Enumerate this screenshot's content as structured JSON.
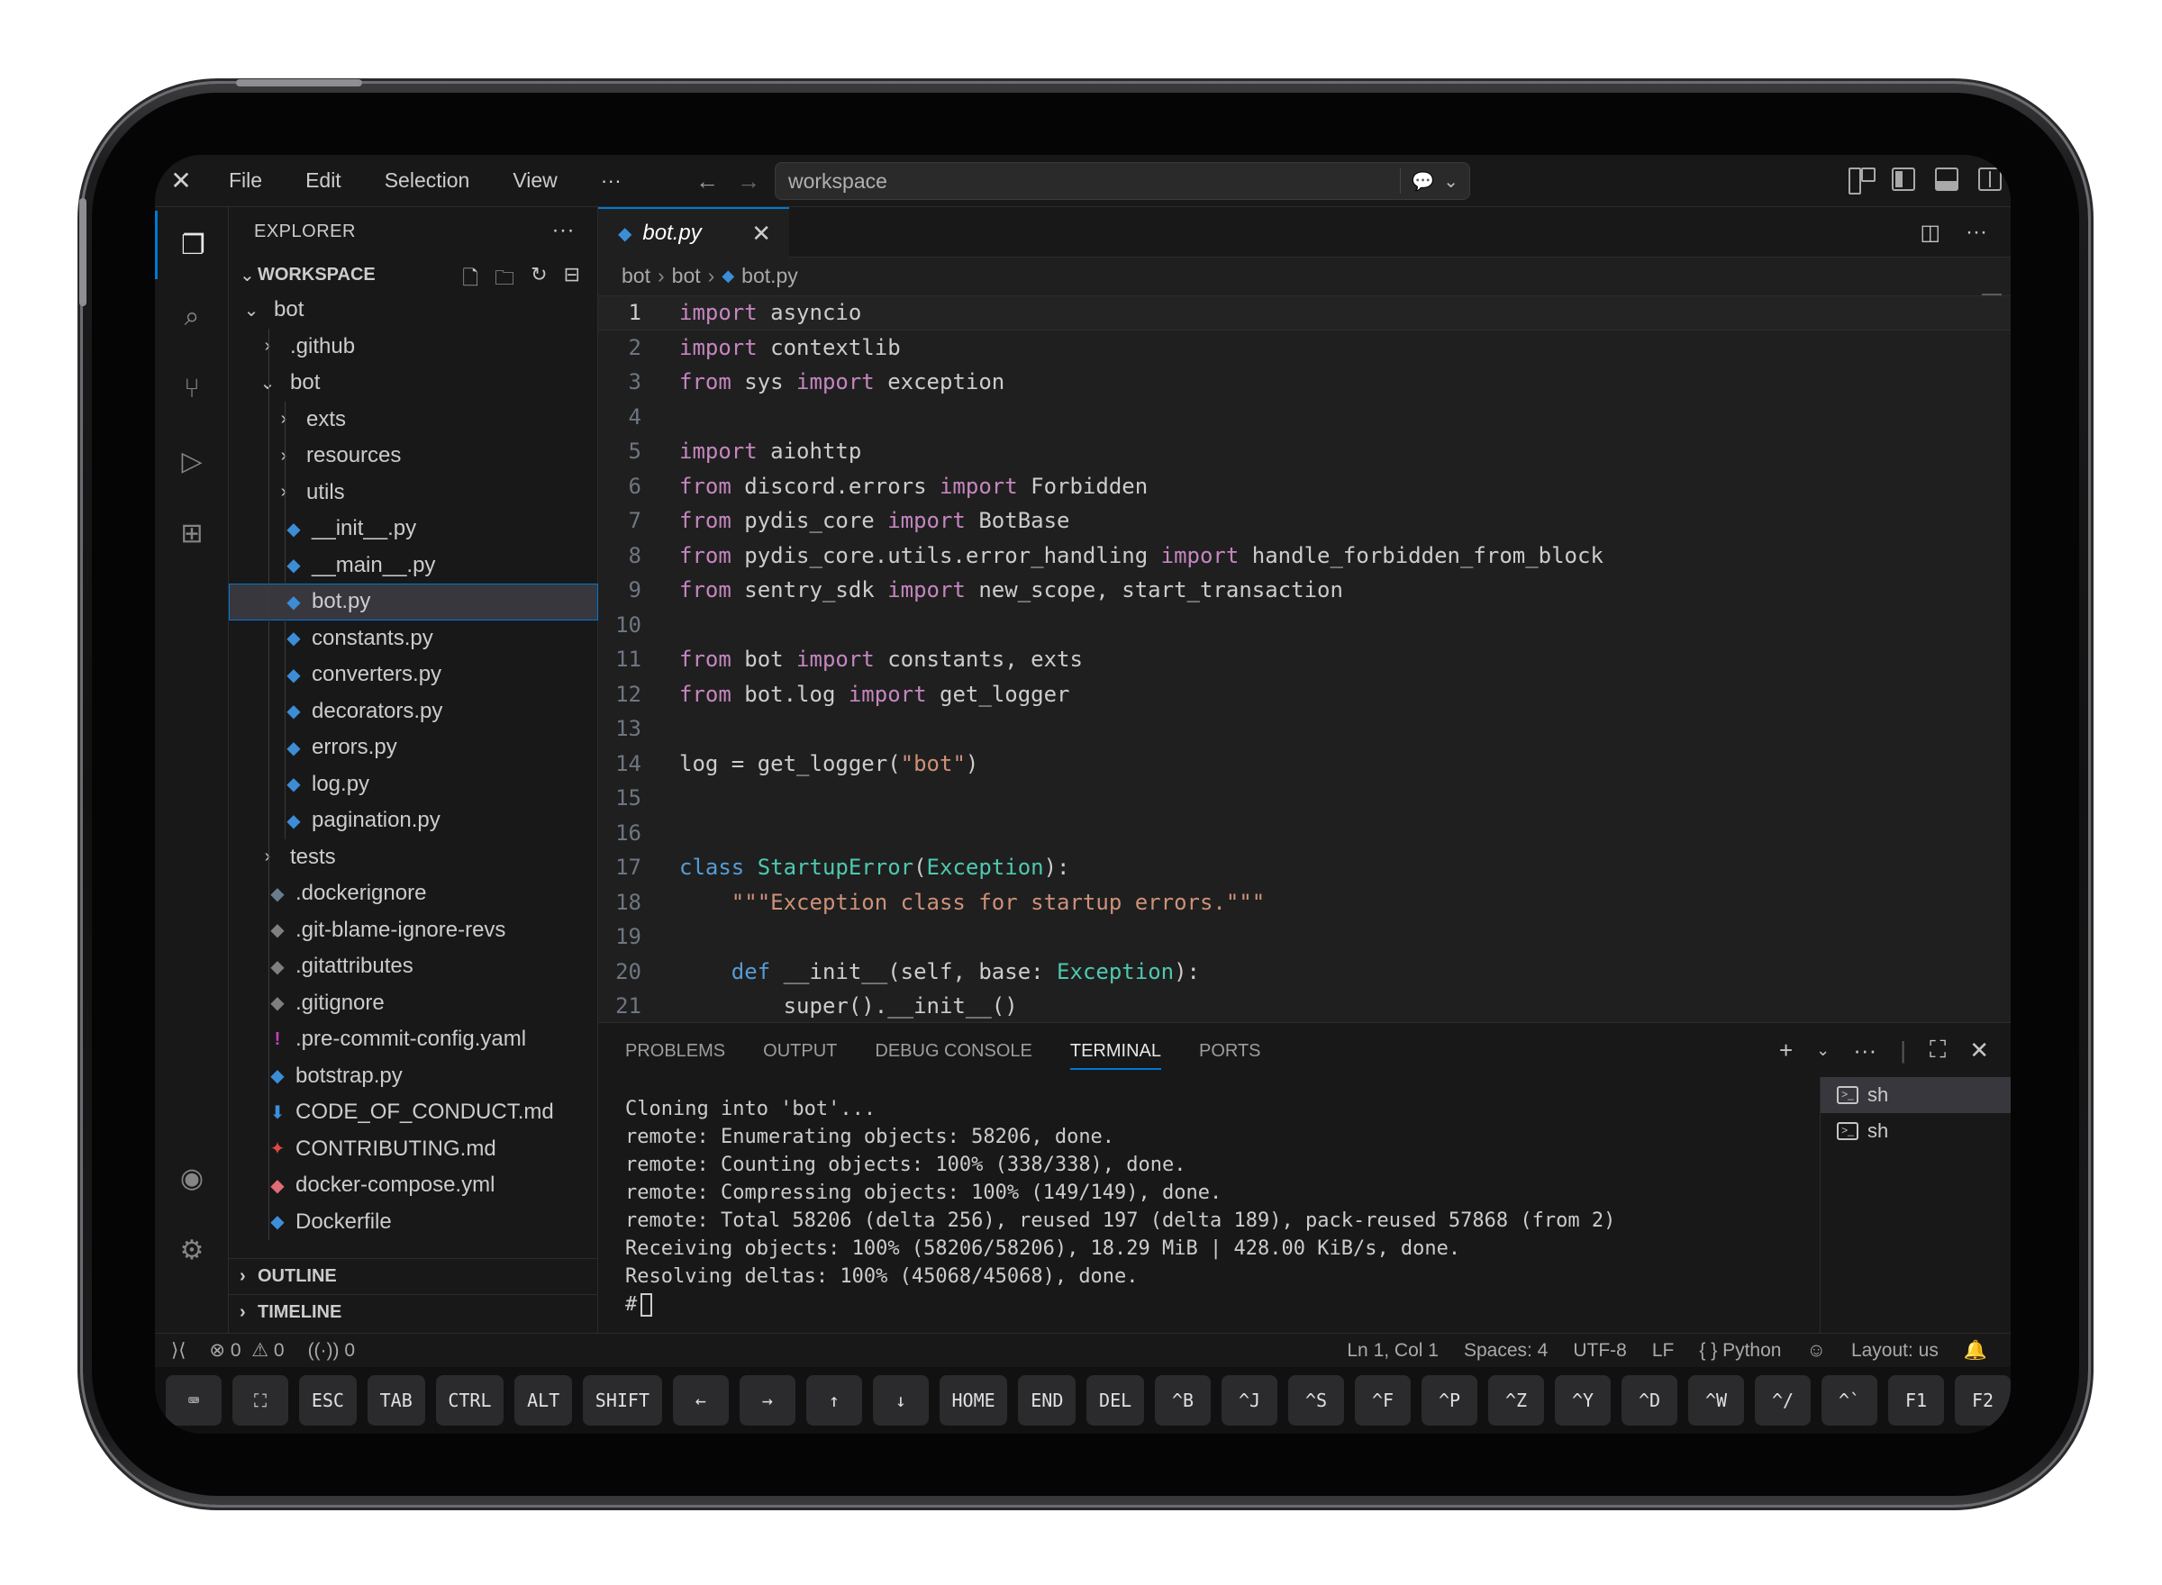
{
  "menu": {
    "items": [
      "File",
      "Edit",
      "Selection",
      "View",
      "···"
    ]
  },
  "search": {
    "text": "workspace"
  },
  "explorer": {
    "title": "EXPLORER",
    "workspace": "WORKSPACE",
    "tree": [
      {
        "label": "bot",
        "depth": 0,
        "kind": "folder-open"
      },
      {
        "label": ".github",
        "depth": 1,
        "kind": "folder"
      },
      {
        "label": "bot",
        "depth": 1,
        "kind": "folder-open"
      },
      {
        "label": "exts",
        "depth": 2,
        "kind": "folder"
      },
      {
        "label": "resources",
        "depth": 2,
        "kind": "folder"
      },
      {
        "label": "utils",
        "depth": 2,
        "kind": "folder"
      },
      {
        "label": "__init__.py",
        "depth": 2,
        "kind": "py"
      },
      {
        "label": "__main__.py",
        "depth": 2,
        "kind": "py"
      },
      {
        "label": "bot.py",
        "depth": 2,
        "kind": "py",
        "selected": true
      },
      {
        "label": "constants.py",
        "depth": 2,
        "kind": "py"
      },
      {
        "label": "converters.py",
        "depth": 2,
        "kind": "py"
      },
      {
        "label": "decorators.py",
        "depth": 2,
        "kind": "py"
      },
      {
        "label": "errors.py",
        "depth": 2,
        "kind": "py"
      },
      {
        "label": "log.py",
        "depth": 2,
        "kind": "py"
      },
      {
        "label": "pagination.py",
        "depth": 2,
        "kind": "py"
      },
      {
        "label": "tests",
        "depth": 1,
        "kind": "folder"
      },
      {
        "label": ".dockerignore",
        "depth": 1,
        "kind": "dockerignore"
      },
      {
        "label": ".git-blame-ignore-revs",
        "depth": 1,
        "kind": "git"
      },
      {
        "label": ".gitattributes",
        "depth": 1,
        "kind": "git"
      },
      {
        "label": ".gitignore",
        "depth": 1,
        "kind": "git"
      },
      {
        "label": ".pre-commit-config.yaml",
        "depth": 1,
        "kind": "yaml"
      },
      {
        "label": "botstrap.py",
        "depth": 1,
        "kind": "py"
      },
      {
        "label": "CODE_OF_CONDUCT.md",
        "depth": 1,
        "kind": "md"
      },
      {
        "label": "CONTRIBUTING.md",
        "depth": 1,
        "kind": "md-red"
      },
      {
        "label": "docker-compose.yml",
        "depth": 1,
        "kind": "compose"
      },
      {
        "label": "Dockerfile",
        "depth": 1,
        "kind": "dockerfile"
      }
    ],
    "outline": "OUTLINE",
    "timeline": "TIMELINE"
  },
  "editor": {
    "tab": "bot.py",
    "breadcrumb": [
      "bot",
      "bot",
      "bot.py"
    ],
    "lines": [
      {
        "n": "1",
        "tokens": [
          [
            "k",
            "import"
          ],
          [
            "p",
            " asyncio"
          ]
        ]
      },
      {
        "n": "2",
        "tokens": [
          [
            "k",
            "import"
          ],
          [
            "p",
            " contextlib"
          ]
        ]
      },
      {
        "n": "3",
        "tokens": [
          [
            "k",
            "from"
          ],
          [
            "p",
            " sys "
          ],
          [
            "k",
            "import"
          ],
          [
            "p",
            " exception"
          ]
        ]
      },
      {
        "n": "4",
        "tokens": []
      },
      {
        "n": "5",
        "tokens": [
          [
            "k",
            "import"
          ],
          [
            "p",
            " aiohttp"
          ]
        ]
      },
      {
        "n": "6",
        "tokens": [
          [
            "k",
            "from"
          ],
          [
            "p",
            " discord.errors "
          ],
          [
            "k",
            "import"
          ],
          [
            "p",
            " Forbidden"
          ]
        ]
      },
      {
        "n": "7",
        "tokens": [
          [
            "k",
            "from"
          ],
          [
            "p",
            " pydis_core "
          ],
          [
            "k",
            "import"
          ],
          [
            "p",
            " BotBase"
          ]
        ]
      },
      {
        "n": "8",
        "tokens": [
          [
            "k",
            "from"
          ],
          [
            "p",
            " pydis_core.utils.error_handling "
          ],
          [
            "k",
            "import"
          ],
          [
            "p",
            " handle_forbidden_from_block"
          ]
        ]
      },
      {
        "n": "9",
        "tokens": [
          [
            "k",
            "from"
          ],
          [
            "p",
            " sentry_sdk "
          ],
          [
            "k",
            "import"
          ],
          [
            "p",
            " new_scope, start_transaction"
          ]
        ]
      },
      {
        "n": "10",
        "tokens": []
      },
      {
        "n": "11",
        "tokens": [
          [
            "k",
            "from"
          ],
          [
            "p",
            " bot "
          ],
          [
            "k",
            "import"
          ],
          [
            "p",
            " constants, exts"
          ]
        ]
      },
      {
        "n": "12",
        "tokens": [
          [
            "k",
            "from"
          ],
          [
            "p",
            " bot.log "
          ],
          [
            "k",
            "import"
          ],
          [
            "p",
            " get_logger"
          ]
        ]
      },
      {
        "n": "13",
        "tokens": []
      },
      {
        "n": "14",
        "tokens": [
          [
            "p",
            "log = get_logger("
          ],
          [
            "s",
            "\"bot\""
          ],
          [
            "p",
            ")"
          ]
        ]
      },
      {
        "n": "15",
        "tokens": []
      },
      {
        "n": "16",
        "tokens": []
      },
      {
        "n": "17",
        "tokens": [
          [
            "d",
            "class"
          ],
          [
            "p",
            " "
          ],
          [
            "c",
            "StartupError"
          ],
          [
            "p",
            "("
          ],
          [
            "c",
            "Exception"
          ],
          [
            "p",
            "):"
          ]
        ]
      },
      {
        "n": "18",
        "tokens": [
          [
            "p",
            "    "
          ],
          [
            "s",
            "\"\"\"Exception class for startup errors.\"\"\""
          ]
        ]
      },
      {
        "n": "19",
        "tokens": []
      },
      {
        "n": "20",
        "tokens": [
          [
            "p",
            "    "
          ],
          [
            "d",
            "def"
          ],
          [
            "p",
            " __init__(self, base: "
          ],
          [
            "c",
            "Exception"
          ],
          [
            "p",
            "):"
          ]
        ]
      },
      {
        "n": "21",
        "tokens": [
          [
            "p",
            "        super().__init__()"
          ]
        ]
      }
    ]
  },
  "panel": {
    "tabs": [
      "PROBLEMS",
      "OUTPUT",
      "DEBUG CONSOLE",
      "TERMINAL",
      "PORTS"
    ],
    "active_tab": "TERMINAL",
    "terminal": [
      "Cloning into 'bot'...",
      "remote: Enumerating objects: 58206, done.",
      "remote: Counting objects: 100% (338/338), done.",
      "remote: Compressing objects: 100% (149/149), done.",
      "remote: Total 58206 (delta 256), reused 197 (delta 189), pack-reused 57868 (from 2)",
      "Receiving objects: 100% (58206/58206), 18.29 MiB | 428.00 KiB/s, done.",
      "Resolving deltas: 100% (45068/45068), done.",
      "#"
    ],
    "shells": [
      "sh",
      "sh"
    ]
  },
  "status": {
    "errors": "0",
    "warnings": "0",
    "ports": "0",
    "position": "Ln 1, Col 1",
    "spaces": "Spaces: 4",
    "encoding": "UTF-8",
    "eol": "LF",
    "language": "Python",
    "layout": "Layout: us"
  },
  "keys": [
    "ESC",
    "TAB",
    "CTRL",
    "ALT",
    "SHIFT",
    "←",
    "→",
    "↑",
    "↓",
    "HOME",
    "END",
    "DEL",
    "^B",
    "^J",
    "^S",
    "^F",
    "^P",
    "^Z",
    "^Y",
    "^D",
    "^W",
    "^/",
    "^`",
    "F1",
    "F2"
  ],
  "colors": {
    "accent": "#0078d4",
    "keyword": "#c586c0",
    "class": "#4ec9b0",
    "string": "#ce9178",
    "python_icon": "#3c8dd6"
  }
}
